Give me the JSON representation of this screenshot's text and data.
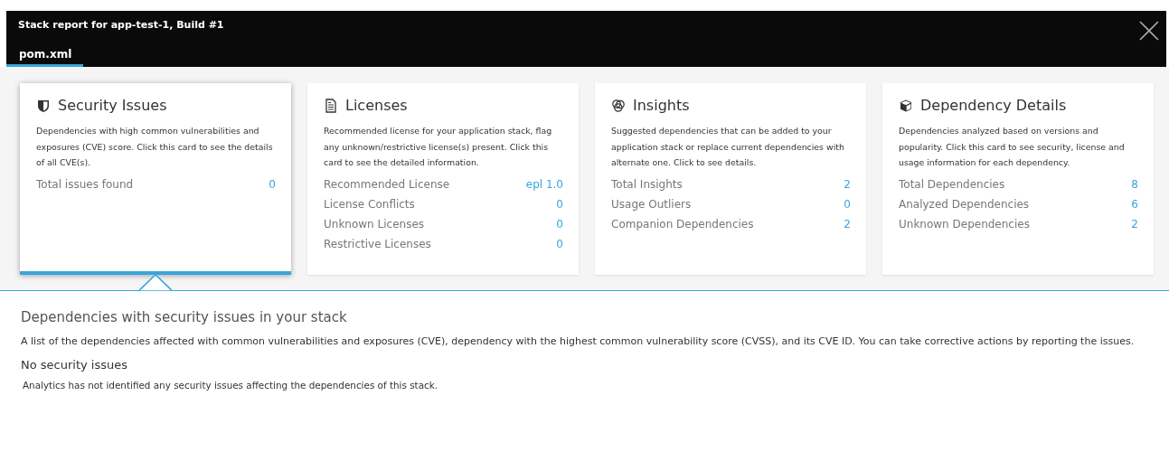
{
  "window": {
    "title": "Stack report for app-test-1, Build #1"
  },
  "tabs": [
    {
      "label": "pom.xml",
      "selected": true
    }
  ],
  "cards": [
    {
      "kind": "security",
      "title": "Security Issues",
      "selected": true,
      "description": "Dependencies with high common vulnerabilities and exposures (CVE) score. Click this card to see the details of all CVE(s).",
      "metrics": [
        {
          "label": "Total issues found",
          "value": "0"
        }
      ]
    },
    {
      "kind": "licenses",
      "title": "Licenses",
      "selected": false,
      "description": "Recommended license for your application stack, flag any unknown/restrictive license(s) present. Click this card to see the detailed information.",
      "metrics": [
        {
          "label": "Recommended License",
          "value": "epl 1.0"
        },
        {
          "label": "License Conflicts",
          "value": "0"
        },
        {
          "label": "Unknown Licenses",
          "value": "0"
        },
        {
          "label": "Restrictive Licenses",
          "value": "0"
        }
      ]
    },
    {
      "kind": "insights",
      "title": "Insights",
      "selected": false,
      "description": "Suggested dependencies that can be added to your application stack or replace current dependencies with alternate one. Click to see details.",
      "metrics": [
        {
          "label": "Total Insights",
          "value": "2"
        },
        {
          "label": "Usage Outliers",
          "value": "0"
        },
        {
          "label": "Companion Dependencies",
          "value": "2"
        }
      ]
    },
    {
      "kind": "dependencies",
      "title": "Dependency Details",
      "selected": false,
      "description": "Dependencies analyzed based on versions and popularity. Click this card to see security, license and usage information for each dependency.",
      "metrics": [
        {
          "label": "Total Dependencies",
          "value": "8"
        },
        {
          "label": "Analyzed Dependencies",
          "value": "6"
        },
        {
          "label": "Unknown Dependencies",
          "value": "2"
        }
      ]
    }
  ],
  "detail": {
    "heading": "Dependencies with security issues in your stack",
    "description": "A list of the dependencies affected with common vulnerabilities and exposures (CVE), dependency with the highest common vulnerability score (CVSS), and its CVE ID. You can take corrective actions by reporting the issues.",
    "status_heading": "No security issues",
    "status_text": "Analytics has not identified any security issues affecting the dependencies of this stack."
  }
}
